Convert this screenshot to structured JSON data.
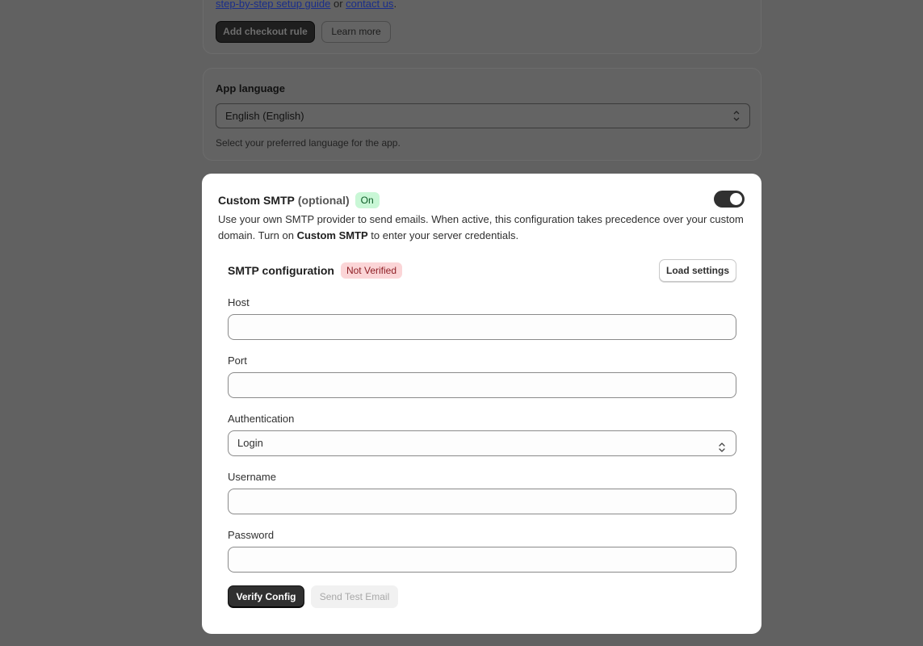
{
  "background": {
    "guide": {
      "link1": "step-by-step setup guide",
      "sep": " or ",
      "link2": "contact us",
      "end": "."
    },
    "add_rule_label": "Add checkout rule",
    "learn_more_label": "Learn more",
    "app_language": {
      "title": "App language",
      "selected": "English (English)",
      "help": "Select your preferred language for the app."
    }
  },
  "smtp": {
    "title": "Custom SMTP",
    "optional": "(optional)",
    "status_badge": "On",
    "toggle_on": true,
    "description": {
      "part1": "Use your own SMTP provider to send emails. When active, this configuration takes precedence over your custom domain. Turn on ",
      "bold": "Custom SMTP",
      "part2": " to enter your server credentials."
    },
    "config": {
      "title": "SMTP configuration",
      "verification_badge": "Not Verified",
      "load_settings_label": "Load settings"
    },
    "fields": {
      "host": {
        "label": "Host",
        "value": ""
      },
      "port": {
        "label": "Port",
        "value": ""
      },
      "authentication": {
        "label": "Authentication",
        "selected": "Login"
      },
      "username": {
        "label": "Username",
        "value": ""
      },
      "password": {
        "label": "Password",
        "value": ""
      }
    },
    "actions": {
      "verify_label": "Verify Config",
      "send_test_label": "Send Test Email"
    }
  },
  "colors": {
    "overlay": "#616161",
    "on_badge_bg": "#c9f7d6",
    "not_verified_bg": "#fbd5d7",
    "primary_button": "#303030"
  }
}
